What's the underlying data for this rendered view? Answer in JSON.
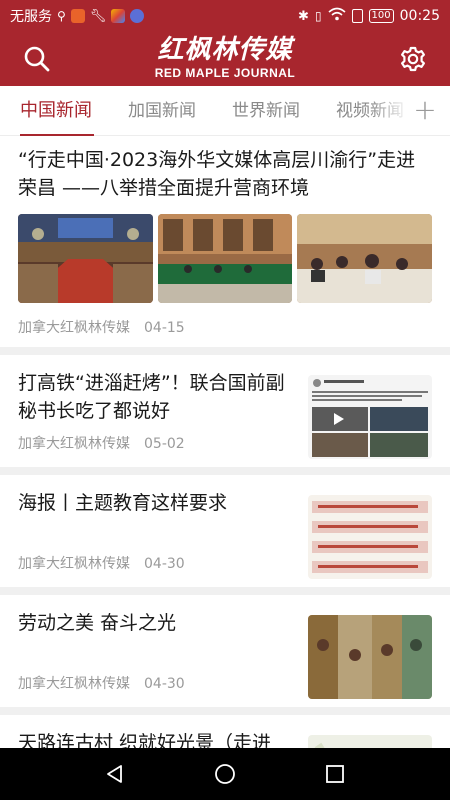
{
  "status_bar": {
    "carrier": "无服务",
    "battery": "100",
    "time": "00:25"
  },
  "header": {
    "logo_cn": "红枫林传媒",
    "logo_en": "RED MAPLE JOURNAL",
    "search_icon": "search-icon",
    "settings_icon": "gear-icon"
  },
  "tabs": [
    {
      "label": "中国新闻",
      "active": true
    },
    {
      "label": "加国新闻",
      "active": false
    },
    {
      "label": "世界新闻",
      "active": false
    },
    {
      "label": "视频新闻",
      "active": false
    }
  ],
  "tab_add": "+",
  "articles": [
    {
      "title": "“行走中国·2023海外华文媒体高层川渝行”走进荣昌 ——八举措全面提升营商环境",
      "source": "加拿大红枫林传媒",
      "date": "04-15"
    },
    {
      "title": "打高铁“进淄赶烤”！联合国前副秘书长吃了都说好",
      "source": "加拿大红枫林传媒",
      "date": "05-02"
    },
    {
      "title": "海报丨主题教育这样要求",
      "source": "加拿大红枫林传媒",
      "date": "04-30"
    },
    {
      "title": "劳动之美 奋斗之光",
      "source": "加拿大红枫林传媒",
      "date": "04-30"
    },
    {
      "title": "天路连古村 织就好光景（走进传统村落）",
      "source": "",
      "date": ""
    }
  ],
  "colors": {
    "brand": "#a8262e",
    "tab_active": "#a8262e",
    "meta": "#9a9a9a"
  }
}
